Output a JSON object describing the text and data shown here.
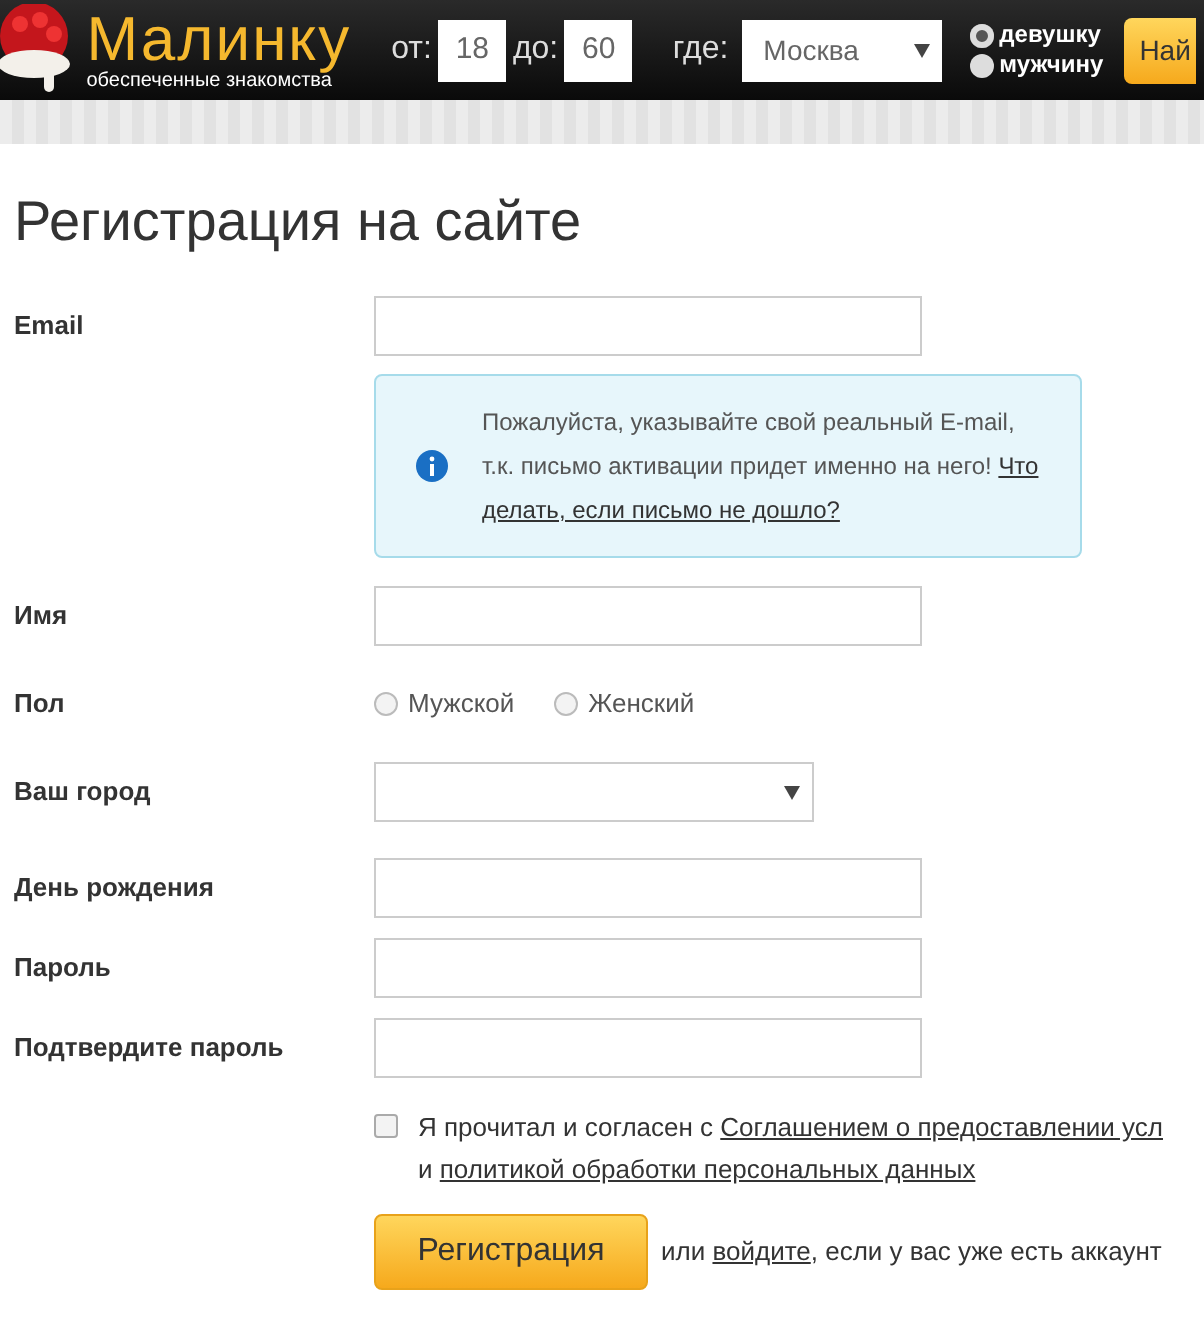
{
  "header": {
    "logo": "Малинку",
    "tagline": "обеспеченные знакомства",
    "age_from_label": "от:",
    "age_from": "18",
    "age_to_label": "до:",
    "age_to": "60",
    "where_label": "где:",
    "city": "Москва",
    "gender_options": [
      {
        "label": "девушку",
        "selected": true
      },
      {
        "label": "мужчину",
        "selected": false
      }
    ],
    "search_button": "Най"
  },
  "title": "Регистрация на сайте",
  "fields": [
    {
      "kind": "input",
      "label": "Email"
    },
    {
      "kind": "info",
      "text": "Пожалуйста, указывайте свой реальный E-mail, т.к. письмо активации придет именно на него! ",
      "link_1": "Что",
      "link_2": "делать, если письмо не дошло?"
    },
    {
      "kind": "input",
      "label": "Имя"
    },
    {
      "kind": "radios",
      "label": "Пол",
      "options": [
        {
          "label": "Мужской",
          "selected": false
        },
        {
          "label": "Женский",
          "selected": false
        }
      ]
    },
    {
      "kind": "select",
      "label": "Ваш город"
    },
    {
      "kind": "input",
      "label": "День рождения"
    },
    {
      "kind": "input",
      "label": "Пароль"
    },
    {
      "kind": "input",
      "label": "Подтвердите пароль"
    }
  ],
  "agreement": {
    "checked": false,
    "text_1": "Я прочитал и согласен с ",
    "link_1": "Соглашением о предоставлении усл",
    "text_2": "и ",
    "link_2": "политикой обработки персональных данных"
  },
  "submit": "Регистрация",
  "alt_text_1": "или ",
  "alt_link": "войдите",
  "alt_text_2": ", если у вас уже есть аккаунт"
}
